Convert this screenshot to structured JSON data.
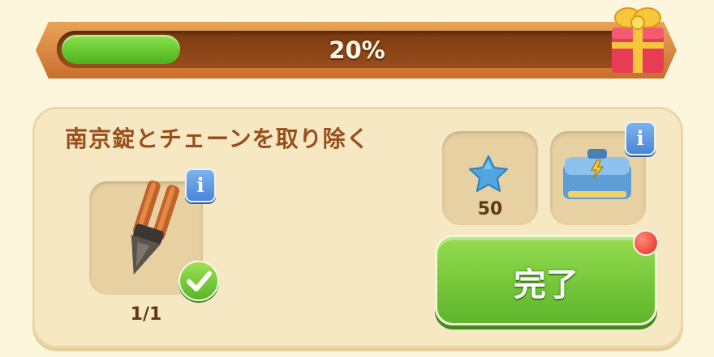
{
  "progress": {
    "label": "20%",
    "value": 0.2
  },
  "task": {
    "title": "南京錠とチェーンを取り除く",
    "item_count": "1/1",
    "item_icon": "bolt-cutter-icon"
  },
  "rewards": [
    {
      "icon": "blue-star-icon",
      "value": "50"
    },
    {
      "icon": "toolbox-icon",
      "value": ""
    }
  ],
  "actions": {
    "complete_label": "完了"
  },
  "colors": {
    "progress_fill": "#5fc22d",
    "button_green": "#6cc236",
    "title_brown": "#9a4f1b",
    "info_blue": "#4a85d6",
    "notif_red": "#e82a1c"
  }
}
